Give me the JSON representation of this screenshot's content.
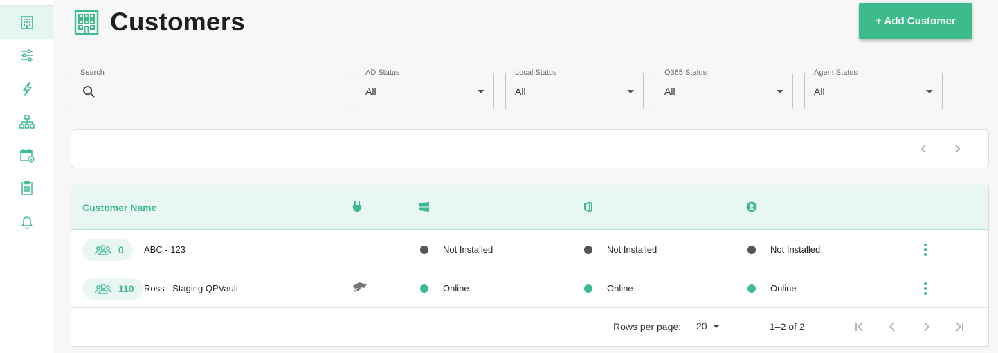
{
  "header": {
    "title": "Customers",
    "add_button_label": "+ Add Customer"
  },
  "sidebar": {
    "items": [
      {
        "name": "customers",
        "icon": "building-icon",
        "active": true
      },
      {
        "name": "settings",
        "icon": "sliders-icon"
      },
      {
        "name": "activity",
        "icon": "lightning-icon"
      },
      {
        "name": "hierarchy",
        "icon": "sitemap-icon"
      },
      {
        "name": "schedule",
        "icon": "calendar-check-icon"
      },
      {
        "name": "reports",
        "icon": "clipboard-icon"
      },
      {
        "name": "alerts",
        "icon": "bell-icon"
      }
    ]
  },
  "filters": {
    "search": {
      "label": "Search",
      "value": "",
      "placeholder": ""
    },
    "ad_status": {
      "label": "AD Status",
      "value": "All"
    },
    "local_status": {
      "label": "Local Status",
      "value": "All"
    },
    "o365_status": {
      "label": "O365 Status",
      "value": "All"
    },
    "agent_status": {
      "label": "Agent Status",
      "value": "All"
    }
  },
  "table": {
    "header": {
      "customer_name": "Customer Name",
      "icons": [
        "plug-icon",
        "windows-icon",
        "office-icon",
        "user-circle-icon"
      ]
    },
    "rows": [
      {
        "count": "0",
        "name": "ABC - 123",
        "connector": "",
        "windows_status": "Not Installed",
        "office_status": "Not Installed",
        "agent_status": "Not Installed",
        "status_color": "#555555"
      },
      {
        "count": "110",
        "name": "Ross - Staging QPVault",
        "connector": "connector-icon",
        "windows_status": "Online",
        "office_status": "Online",
        "agent_status": "Online",
        "status_color": "#3dbb8d"
      }
    ],
    "footer": {
      "rows_per_page_label": "Rows per page:",
      "rows_per_page_value": "20",
      "range": "1–2 of 2"
    }
  },
  "colors": {
    "accent": "#3dbb8d",
    "accent_light": "#e8f8f1",
    "offline": "#555555"
  }
}
